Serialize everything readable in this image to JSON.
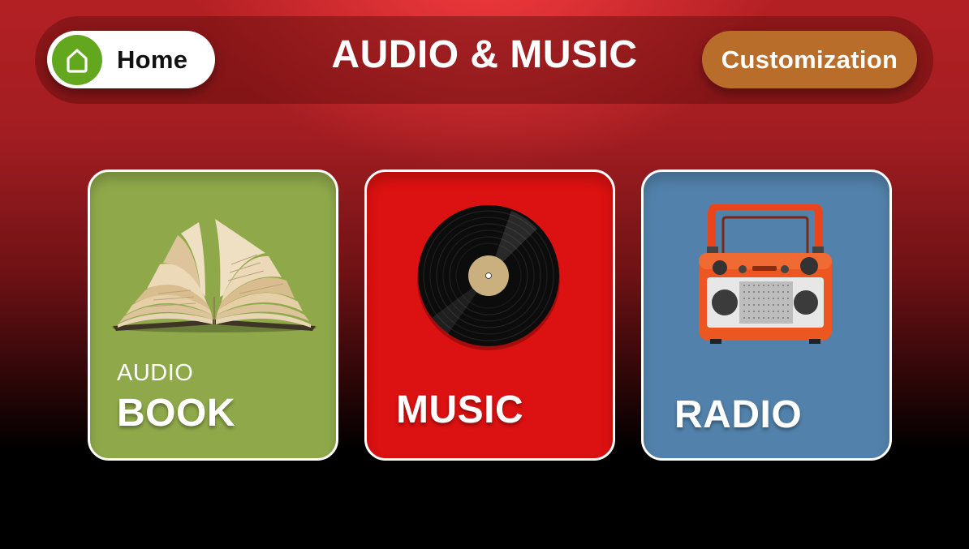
{
  "header": {
    "title": "AUDIO & MUSIC",
    "home_label": "Home",
    "customization_label": "Customization"
  },
  "cards": [
    {
      "id": "audio-book",
      "small_label": "AUDIO",
      "label": "BOOK",
      "color": "#8fa94a",
      "icon": "open-book-icon"
    },
    {
      "id": "music",
      "label": "MUSIC",
      "color": "#dc1111",
      "icon": "vinyl-record-icon"
    },
    {
      "id": "radio",
      "label": "RADIO",
      "color": "#5282ab",
      "icon": "radio-icon"
    }
  ],
  "colors": {
    "home_accent": "#63a71f",
    "customization_button": "#b96d2a"
  }
}
